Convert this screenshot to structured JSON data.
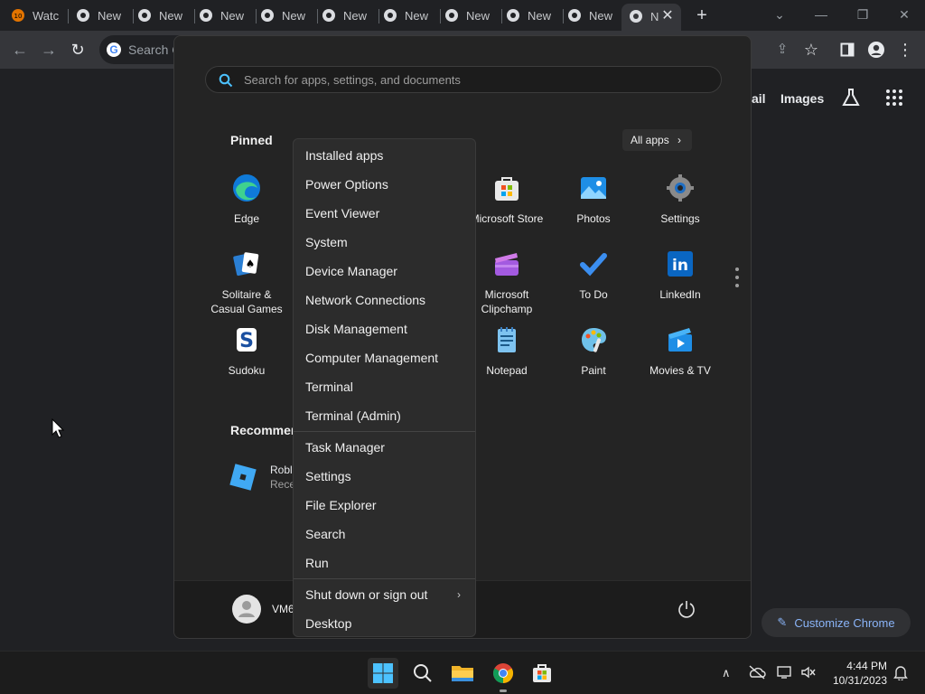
{
  "browser": {
    "tabs": [
      {
        "label": "Watc",
        "icon": "youtube-icon"
      },
      {
        "label": "New",
        "icon": "chrome-icon"
      },
      {
        "label": "New",
        "icon": "chrome-icon"
      },
      {
        "label": "New",
        "icon": "chrome-icon"
      },
      {
        "label": "New",
        "icon": "chrome-icon"
      },
      {
        "label": "New",
        "icon": "chrome-icon"
      },
      {
        "label": "New",
        "icon": "chrome-icon"
      },
      {
        "label": "New",
        "icon": "chrome-icon"
      },
      {
        "label": "New",
        "icon": "chrome-icon"
      },
      {
        "label": "New",
        "icon": "chrome-icon"
      },
      {
        "label": "N",
        "icon": "chrome-icon"
      }
    ],
    "omnibox_placeholder": "Search G",
    "ntp_links": {
      "gmail": "ail",
      "images": "Images"
    },
    "customize_label": "Customize Chrome"
  },
  "start_menu": {
    "search_placeholder": "Search for apps, settings, and documents",
    "pinned_title": "Pinned",
    "all_apps_label": "All apps",
    "pinned_apps": [
      {
        "label": "Edge",
        "icon": "edge-icon"
      },
      {
        "label": "Microsoft Store",
        "icon": "store-icon"
      },
      {
        "label": "Photos",
        "icon": "photos-icon"
      },
      {
        "label": "Settings",
        "icon": "settings-gear-icon"
      },
      {
        "label": "Solitaire & Casual Games",
        "icon": "solitaire-icon"
      },
      {
        "label": "Microsoft Clipchamp",
        "icon": "clipchamp-icon"
      },
      {
        "label": "To Do",
        "icon": "todo-icon"
      },
      {
        "label": "LinkedIn",
        "icon": "linkedin-icon"
      },
      {
        "label": "Sudoku",
        "icon": "sudoku-icon"
      },
      {
        "label": "Notepad",
        "icon": "notepad-icon"
      },
      {
        "label": "Paint",
        "icon": "paint-icon"
      },
      {
        "label": "Movies & TV",
        "icon": "movies-icon"
      }
    ],
    "recommended_title": "Recommen",
    "recommended": [
      {
        "title": "Robl",
        "subtitle": "Rece",
        "icon": "roblox-icon"
      }
    ],
    "user_name": "VM6"
  },
  "context_menu": {
    "group1": [
      "Installed apps",
      "Power Options",
      "Event Viewer",
      "System",
      "Device Manager",
      "Network Connections",
      "Disk Management",
      "Computer Management",
      "Terminal",
      "Terminal (Admin)"
    ],
    "group2": [
      "Task Manager",
      "Settings",
      "File Explorer",
      "Search",
      "Run"
    ],
    "group3": [
      "Shut down or sign out",
      "Desktop"
    ]
  },
  "taskbar": {
    "time": "4:44 PM",
    "date": "10/31/2023"
  },
  "colors": {
    "accent": "#0078d4",
    "chrome_link": "#8ab4f8"
  }
}
